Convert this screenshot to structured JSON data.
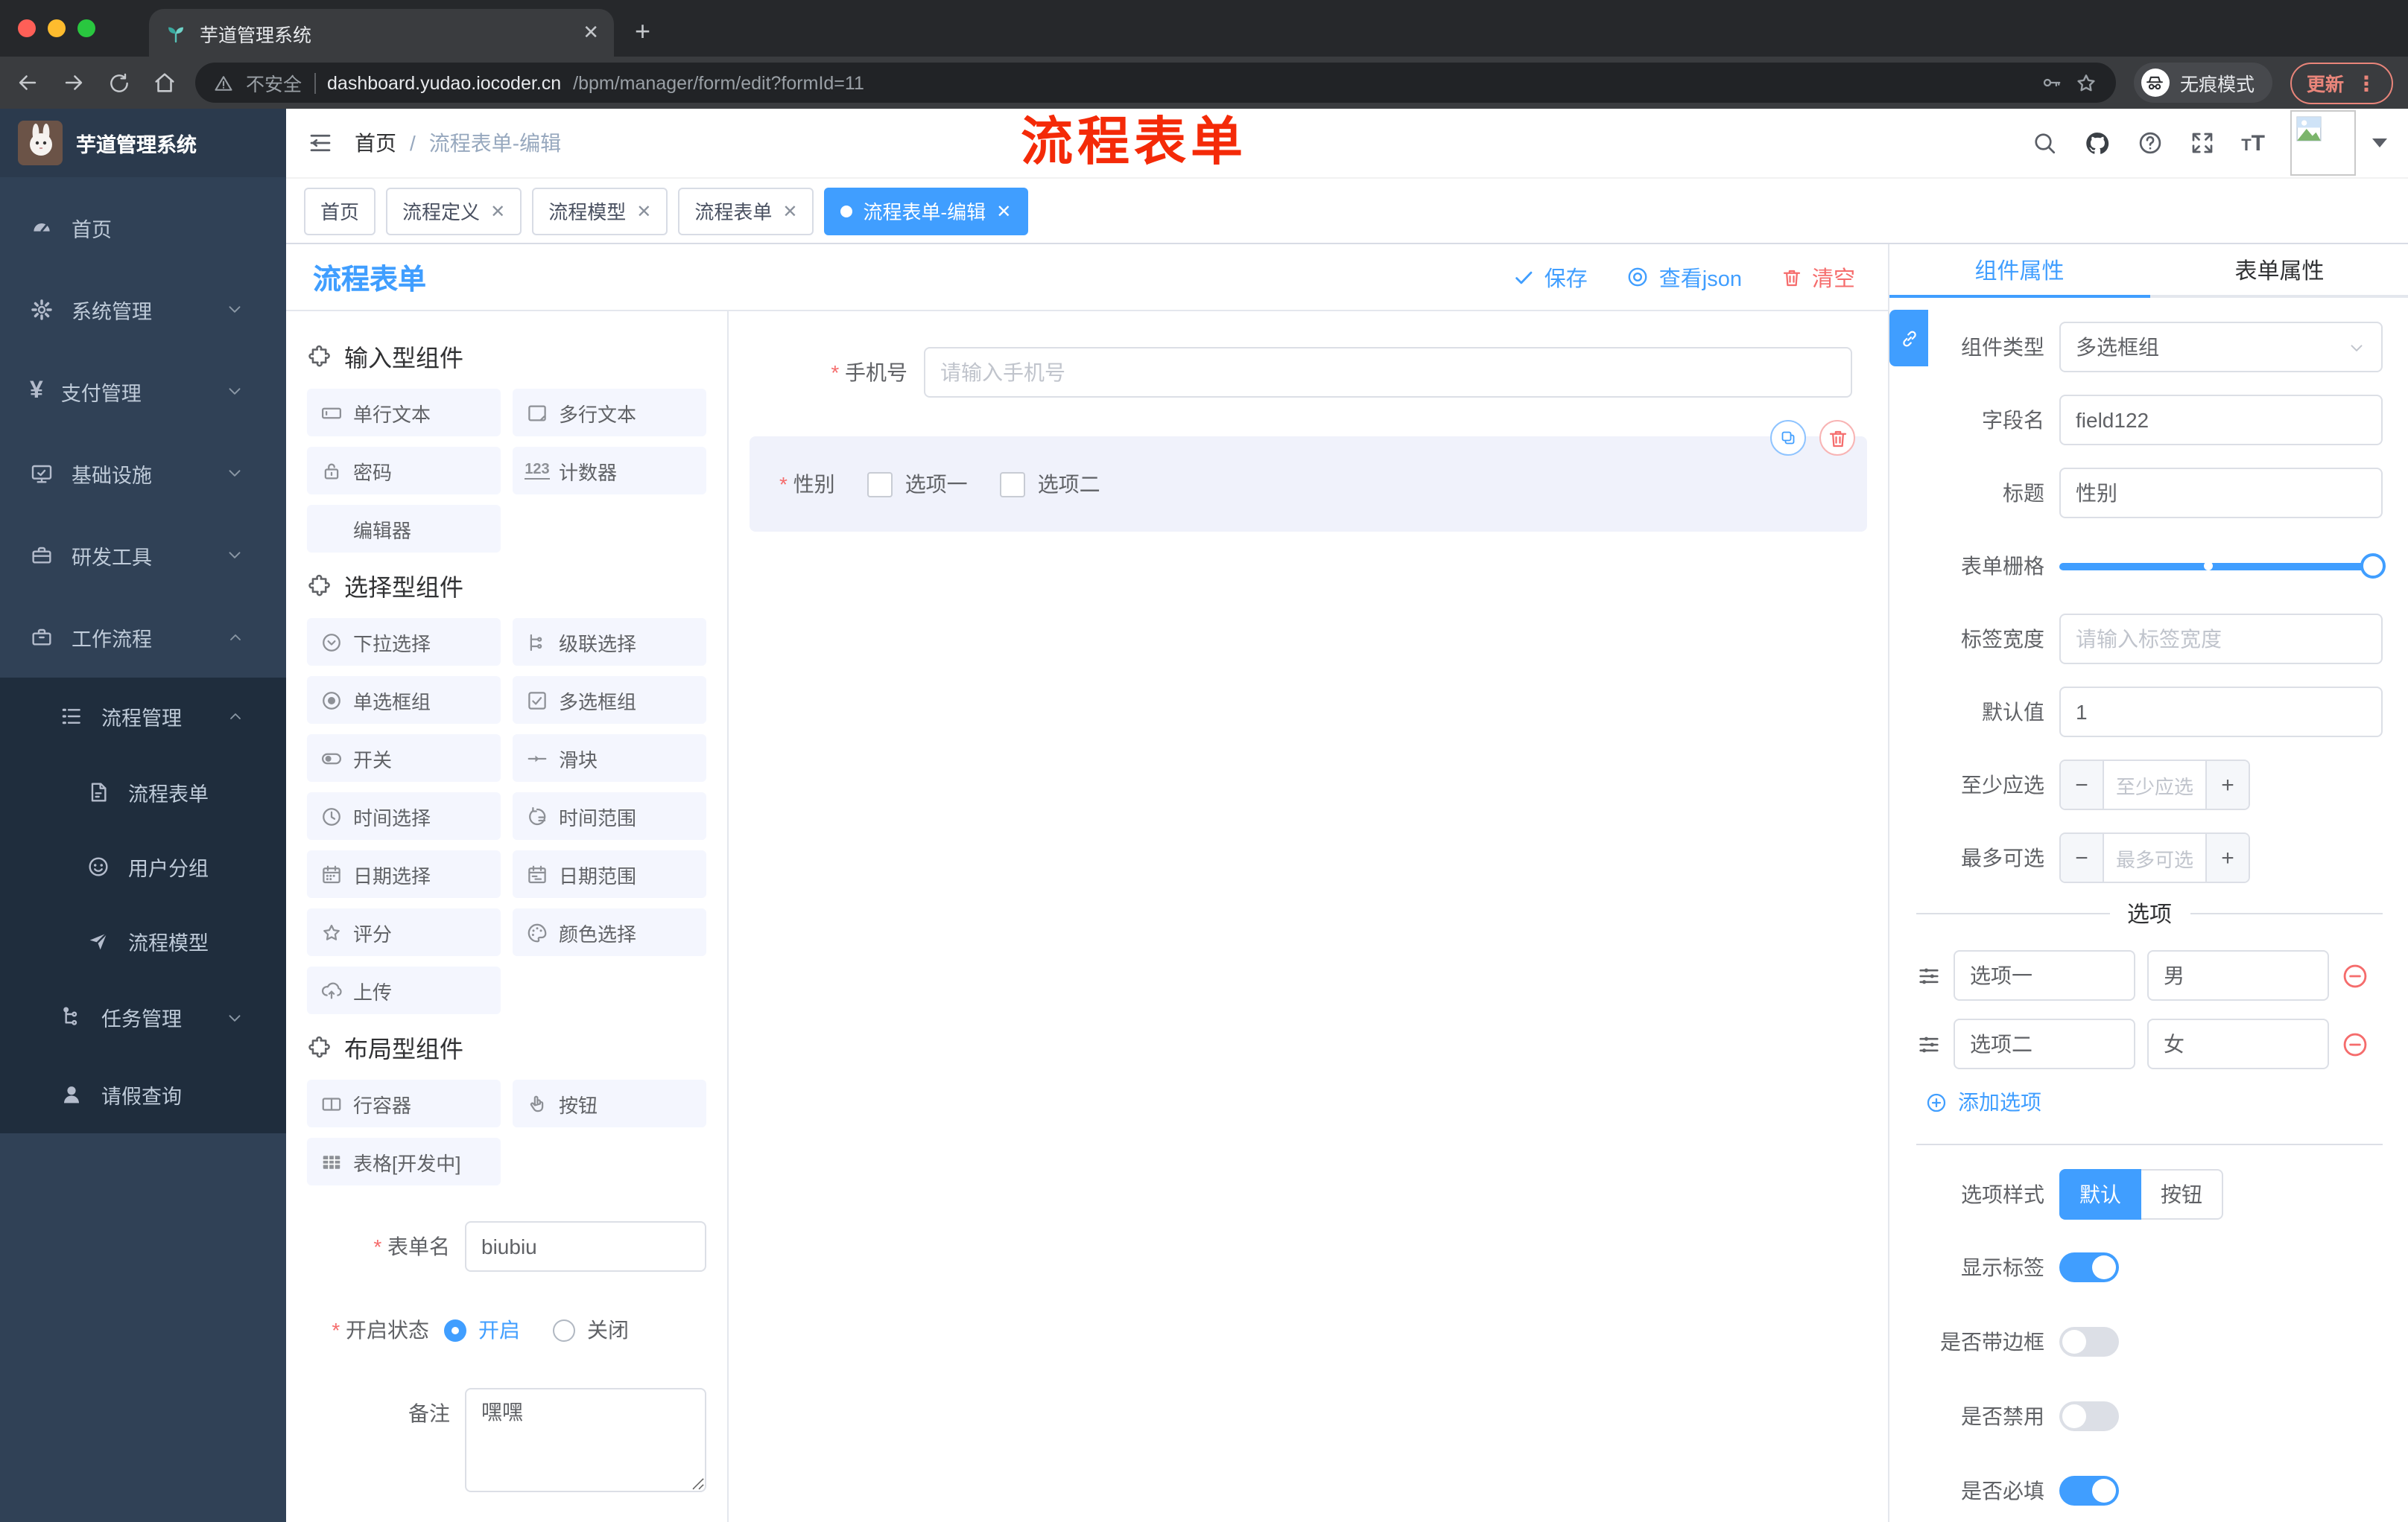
{
  "browser": {
    "tab_title": "芋道管理系统",
    "new_tab": "+",
    "url": {
      "insecure": "不安全",
      "domain": "dashboard.yudao.iocoder.cn",
      "path": "/bpm/manager/form/edit?formId=11"
    },
    "incognito": "无痕模式",
    "update": "更新"
  },
  "sidebar": {
    "title": "芋道管理系统",
    "items": [
      {
        "icon": "dashboard",
        "label": "首页",
        "level": 1,
        "chevron": "",
        "dark": false
      },
      {
        "icon": "gear",
        "label": "系统管理",
        "level": 1,
        "chevron": "down",
        "dark": false
      },
      {
        "icon": "yen",
        "label": "支付管理",
        "level": 1,
        "chevron": "down",
        "dark": false
      },
      {
        "icon": "monitor",
        "label": "基础设施",
        "level": 1,
        "chevron": "down",
        "dark": false
      },
      {
        "icon": "toolbox",
        "label": "研发工具",
        "level": 1,
        "chevron": "down",
        "dark": false
      },
      {
        "icon": "briefcase",
        "label": "工作流程",
        "level": 1,
        "chevron": "up",
        "dark": false
      },
      {
        "icon": "list",
        "label": "流程管理",
        "level": 2,
        "chevron": "up",
        "dark": true
      },
      {
        "icon": "doc",
        "label": "流程表单",
        "level": 3,
        "chevron": "",
        "dark": true
      },
      {
        "icon": "face",
        "label": "用户分组",
        "level": 3,
        "chevron": "",
        "dark": true
      },
      {
        "icon": "send",
        "label": "流程模型",
        "level": 3,
        "chevron": "",
        "dark": true
      },
      {
        "icon": "tree",
        "label": "任务管理",
        "level": 2,
        "chevron": "down",
        "dark": true
      },
      {
        "icon": "user",
        "label": "请假查询",
        "level": 2,
        "chevron": "",
        "dark": true
      }
    ]
  },
  "header": {
    "breadcrumb_root": "首页",
    "breadcrumb_current": "流程表单-编辑",
    "annotation": "流程表单"
  },
  "tags": [
    {
      "label": "首页",
      "closable": false,
      "active": false
    },
    {
      "label": "流程定义",
      "closable": true,
      "active": false
    },
    {
      "label": "流程模型",
      "closable": true,
      "active": false
    },
    {
      "label": "流程表单",
      "closable": true,
      "active": false
    },
    {
      "label": "流程表单-编辑",
      "closable": true,
      "active": true
    }
  ],
  "toolbar": {
    "title": "流程表单",
    "save": "保存",
    "view_json": "查看json",
    "clear": "清空"
  },
  "palette": {
    "sections": [
      {
        "title": "输入型组件",
        "items": [
          {
            "icon": "input",
            "label": "单行文本"
          },
          {
            "icon": "textarea",
            "label": "多行文本"
          },
          {
            "icon": "lock",
            "label": "密码"
          },
          {
            "icon": "counter",
            "label": "计数器"
          },
          {
            "icon": "none",
            "label": "编辑器"
          }
        ]
      },
      {
        "title": "选择型组件",
        "items": [
          {
            "icon": "select",
            "label": "下拉选择"
          },
          {
            "icon": "cascader",
            "label": "级联选择"
          },
          {
            "icon": "radio",
            "label": "单选框组"
          },
          {
            "icon": "checkbox",
            "label": "多选框组"
          },
          {
            "icon": "switch",
            "label": "开关"
          },
          {
            "icon": "slider",
            "label": "滑块"
          },
          {
            "icon": "time",
            "label": "时间选择"
          },
          {
            "icon": "timerange",
            "label": "时间范围"
          },
          {
            "icon": "date",
            "label": "日期选择"
          },
          {
            "icon": "daterange",
            "label": "日期范围"
          },
          {
            "icon": "rate",
            "label": "评分"
          },
          {
            "icon": "color",
            "label": "颜色选择"
          },
          {
            "icon": "upload",
            "label": "上传"
          }
        ]
      },
      {
        "title": "布局型组件",
        "items": [
          {
            "icon": "row",
            "label": "行容器"
          },
          {
            "icon": "hand",
            "label": "按钮"
          },
          {
            "icon": "table",
            "label": "表格[开发中]"
          }
        ]
      }
    ],
    "meta": {
      "name_label": "表单名",
      "name_value": "biubiu",
      "status_label": "开启状态",
      "status_on": "开启",
      "status_off": "关闭",
      "remark_label": "备注",
      "remark_value": "嘿嘿"
    }
  },
  "canvas": {
    "phone": {
      "label": "手机号",
      "placeholder": "请输入手机号"
    },
    "gender": {
      "label": "性别",
      "options": [
        "选项一",
        "选项二"
      ]
    }
  },
  "props": {
    "tabs": {
      "component": "组件属性",
      "form": "表单属性"
    },
    "fields": {
      "type_label": "组件类型",
      "type_value": "多选框组",
      "field_label": "字段名",
      "field_value": "field122",
      "title_label": "标题",
      "title_value": "性别",
      "grid_label": "表单栅格",
      "label_width_label": "标签宽度",
      "label_width_placeholder": "请输入标签宽度",
      "default_label": "默认值",
      "default_value": "1",
      "min_label": "至少应选",
      "min_placeholder": "至少应选",
      "max_label": "最多可选",
      "max_placeholder": "最多可选"
    },
    "options": {
      "title": "选项",
      "rows": [
        {
          "name": "选项一",
          "value": "男"
        },
        {
          "name": "选项二",
          "value": "女"
        }
      ],
      "add": "添加选项"
    },
    "style": {
      "label": "选项样式",
      "choices": [
        "默认",
        "按钮"
      ],
      "active": "默认"
    },
    "toggles": [
      {
        "label": "显示标签",
        "on": true
      },
      {
        "label": "是否带边框",
        "on": false
      },
      {
        "label": "是否禁用",
        "on": false
      },
      {
        "label": "是否必填",
        "on": true
      }
    ]
  },
  "colors": {
    "accent": "#409eff",
    "danger": "#f56c6c",
    "sidebar_bg": "#304156",
    "submenu_bg": "#1f2d3d",
    "annotation_red": "#f42a08"
  }
}
